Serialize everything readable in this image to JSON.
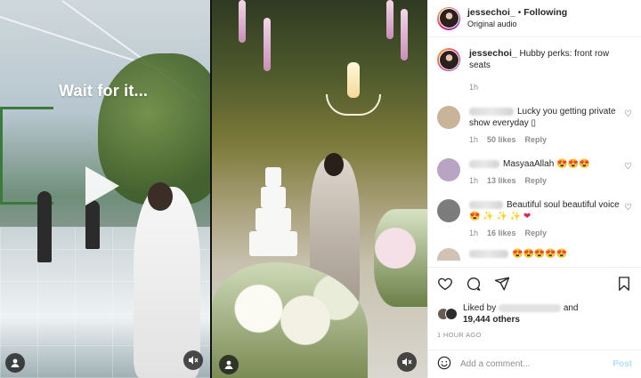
{
  "media": {
    "left_caption": "Wait for it...",
    "icons": {
      "play": "play-icon",
      "user": "user-icon",
      "mute": "mute-icon"
    }
  },
  "header": {
    "username": "jessechoi_",
    "separator": "•",
    "follow_label": "Following",
    "audio_label": "Original audio",
    "more": "···"
  },
  "caption": {
    "username": "jessechoi_",
    "text": "Hubby perks: front row seats",
    "time": "1h"
  },
  "comments": [
    {
      "text": "Lucky you getting private show everyday ▯",
      "time": "1h",
      "likes": "50 likes",
      "reply": "Reply",
      "avatar_color": "#c9b49a"
    },
    {
      "text": "MasyaaAllah",
      "emoji": "😍😍😍",
      "time": "1h",
      "likes": "13 likes",
      "reply": "Reply",
      "avatar_color": "#b9a4c4"
    },
    {
      "text": "Beautiful soul beautiful voice",
      "emoji": "😍 ✨ ✨ ✨ ❤",
      "time": "1h",
      "likes": "16 likes",
      "reply": "Reply",
      "avatar_color": "#7c7c7c"
    }
  ],
  "partial_comment_emoji": "😍😍😍😍😍",
  "likes": {
    "prefix": "Liked by",
    "and": "and",
    "others": "19,444 others"
  },
  "timestamp": "1 HOUR AGO",
  "add_comment": {
    "placeholder": "Add a comment...",
    "post_label": "Post"
  },
  "colors": {
    "text": "#262626",
    "muted": "#8e8e8e",
    "post_disabled": "#b2dffc",
    "border": "#efefef"
  }
}
